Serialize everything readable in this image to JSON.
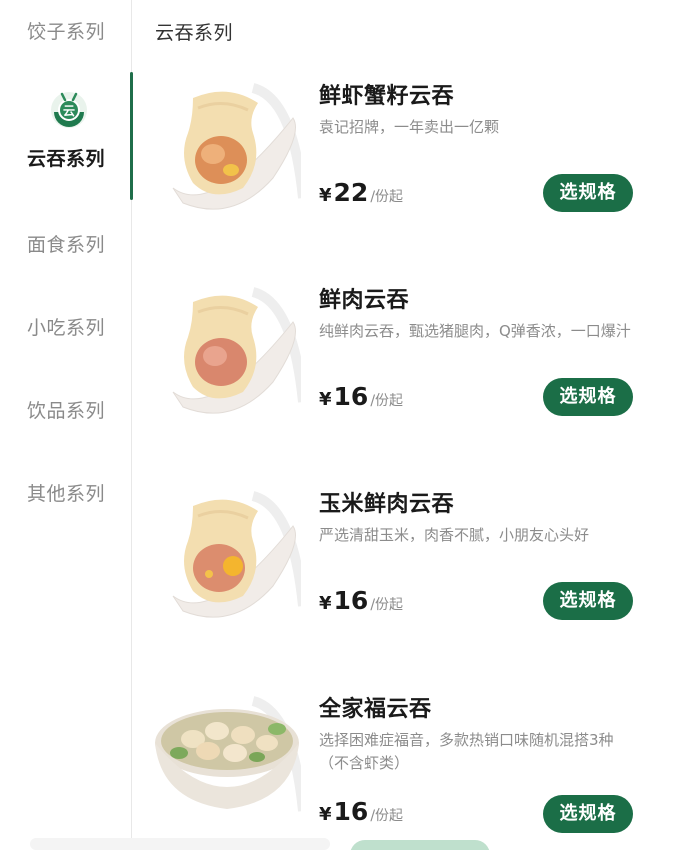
{
  "sidebar": {
    "items": [
      {
        "label": "饺子系列",
        "active": false
      },
      {
        "label": "云吞系列",
        "active": true,
        "icon": "wonton-badge-icon"
      },
      {
        "label": "面食系列",
        "active": false
      },
      {
        "label": "小吃系列",
        "active": false
      },
      {
        "label": "饮品系列",
        "active": false
      },
      {
        "label": "其他系列",
        "active": false
      }
    ]
  },
  "section": {
    "title": "云吞系列"
  },
  "products": [
    {
      "name": "鲜虾蟹籽云吞",
      "desc": "袁记招牌，一年卖出一亿颗",
      "currency": "¥",
      "price": "22",
      "unit": "/份起",
      "button": "选规格",
      "image": "shrimp-wonton-on-spoon"
    },
    {
      "name": "鲜肉云吞",
      "desc": "纯鲜肉云吞，甄选猪腿肉，Q弹香浓，一口爆汁",
      "currency": "¥",
      "price": "16",
      "unit": "/份起",
      "button": "选规格",
      "image": "pork-wonton-on-spoon"
    },
    {
      "name": "玉米鲜肉云吞",
      "desc": "严选清甜玉米，肉香不腻，小朋友心头好",
      "currency": "¥",
      "price": "16",
      "unit": "/份起",
      "button": "选规格",
      "image": "corn-pork-wonton-on-spoon"
    },
    {
      "name": "全家福云吞",
      "desc": "选择困难症福音，多款热销口味随机混搭3种（不含虾类）",
      "currency": "¥",
      "price": "16",
      "unit": "/份起",
      "button": "选规格",
      "image": "wonton-soup-bowl"
    }
  ],
  "colors": {
    "accent": "#1b6e47",
    "sidebar_indicator": "#1f6e4a",
    "muted_text": "#8c8c8c"
  }
}
